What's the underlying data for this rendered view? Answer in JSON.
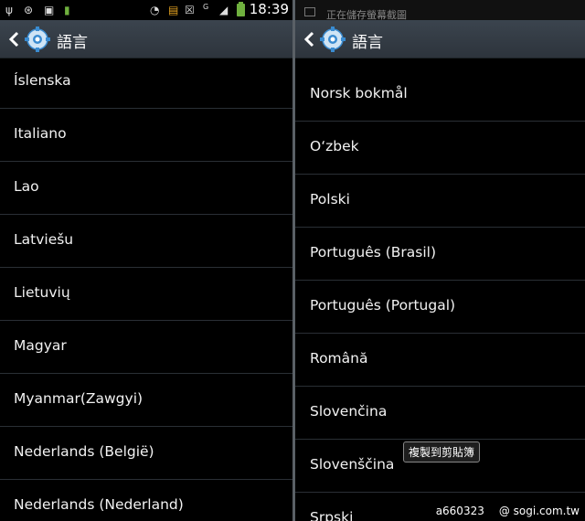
{
  "left": {
    "status": {
      "time": "18:39"
    },
    "title": "語言",
    "items": [
      "Íslenska",
      "Italiano",
      "Lao",
      "Latviešu",
      "Lietuvių",
      "Magyar",
      "Myanmar(Zawgyi)",
      "Nederlands (België)",
      "Nederlands (Nederland)"
    ]
  },
  "right": {
    "notification": "正在儲存螢幕截圖",
    "title": "語言",
    "items": [
      "Norsk bokmål",
      "O‘zbek",
      "Polski",
      "Português (Brasil)",
      "Português (Portugal)",
      "Română",
      "Slovenčina",
      "Slovenščina",
      "Srpski"
    ],
    "toast": "複製到剪貼簿"
  },
  "watermark": {
    "user": "a660323",
    "site": "@ sogi.com.tw"
  },
  "colors": {
    "action_bar": "#333b44",
    "battery": "#6fb03e",
    "divider": "#5a6066"
  }
}
